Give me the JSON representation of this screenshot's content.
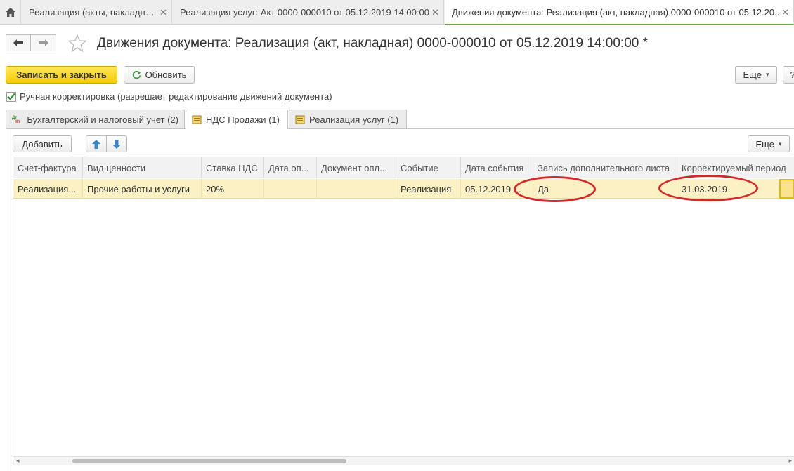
{
  "window_tabs": [
    {
      "label": "Реализация (акты, накладные)",
      "active": false
    },
    {
      "label": "Реализация услуг: Акт 0000-000010 от 05.12.2019 14:00:00",
      "active": false
    },
    {
      "label": "Движения документа: Реализация (акт, накладная) 0000-000010 от 05.12.20...",
      "active": true
    }
  ],
  "icons": {
    "home": "home-icon",
    "back": "arrow-left-icon",
    "forward": "arrow-right-icon",
    "favorite": "star-icon",
    "refresh": "refresh-icon",
    "close": "close-icon",
    "move_up": "arrow-up-icon",
    "move_down": "arrow-down-icon"
  },
  "header": {
    "title": "Движения документа: Реализация (акт, накладная) 0000-000010 от 05.12.2019 14:00:00 *"
  },
  "toolbar": {
    "save_close_label": "Записать и закрыть",
    "refresh_label": "Обновить",
    "more_label": "Еще",
    "help_label": "?"
  },
  "manual_adjust": {
    "label": "Ручная корректировка (разрешает редактирование движений документа)",
    "checked": true
  },
  "tabs": [
    {
      "label": "Бухгалтерский и налоговый учет (2)",
      "icon": "dt-kt-icon",
      "active": false
    },
    {
      "label": "НДС Продажи (1)",
      "icon": "register-icon",
      "active": true
    },
    {
      "label": "Реализация услуг (1)",
      "icon": "register-icon",
      "active": false
    }
  ],
  "grid_toolbar": {
    "add_label": "Добавить",
    "more_label": "Еще"
  },
  "table": {
    "columns": [
      "Счет-фактура",
      "Вид ценности",
      "Ставка НДС",
      "Дата оп...",
      "Документ опл...",
      "Событие",
      "Дата события",
      "Запись дополнительного листа",
      "Корректируемый период"
    ],
    "rows": [
      [
        "Реализация...",
        "Прочие работы и услуги",
        "20%",
        "",
        "",
        "Реализация",
        "05.12.2019 ...",
        "Да",
        "31.03.2019"
      ]
    ]
  },
  "colors": {
    "accent_yellow": "#f5cc00",
    "active_tab_underline": "#6ba84f",
    "row_highlight": "#fbf1c4",
    "annotation_red": "#d6262a"
  }
}
